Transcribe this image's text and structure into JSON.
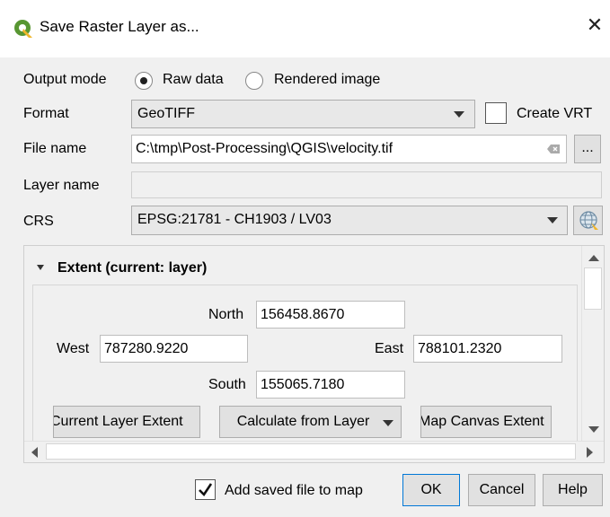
{
  "window": {
    "title": "Save Raster Layer as...",
    "close": "✕"
  },
  "output_mode": {
    "label": "Output mode",
    "options": [
      "Raw data",
      "Rendered image"
    ],
    "selected": "Raw data"
  },
  "format": {
    "label": "Format",
    "value": "GeoTIFF",
    "create_vrt_label": "Create VRT"
  },
  "file_name": {
    "label": "File name",
    "value": "C:\\tmp\\Post-Processing\\QGIS\\velocity.tif",
    "browse": "..."
  },
  "layer_name": {
    "label": "Layer name",
    "value": ""
  },
  "crs": {
    "label": "CRS",
    "value": "EPSG:21781 - CH1903 / LV03"
  },
  "extent": {
    "header": "Extent (current: layer)",
    "north_label": "North",
    "north": "156458.8670",
    "west_label": "West",
    "west": "787280.9220",
    "east_label": "East",
    "east": "788101.2320",
    "south_label": "South",
    "south": "155065.7180",
    "btn_current": "Current Layer Extent",
    "btn_calculate": "Calculate from Layer",
    "btn_canvas": "Map Canvas Extent"
  },
  "footer": {
    "add_saved_label": "Add saved file to map",
    "add_saved_checked": true,
    "ok": "OK",
    "cancel": "Cancel",
    "help": "Help"
  },
  "colors": {
    "qgis_green": "#589632",
    "qgis_yellow": "#f0b62a"
  }
}
